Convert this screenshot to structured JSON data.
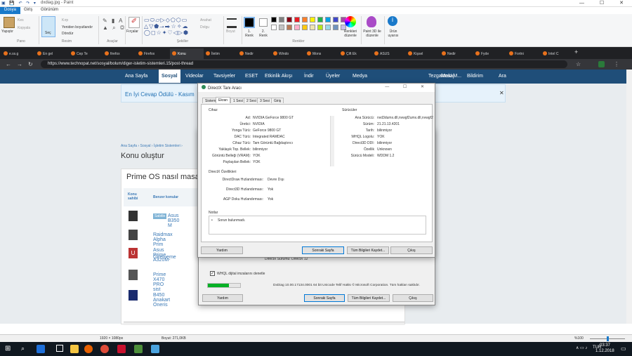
{
  "paint": {
    "title": "dxdiag.jpg - Paint",
    "tabs": [
      "Dosya",
      "Giriş",
      "Görünüm"
    ],
    "clipboard": {
      "paste": "Yapıştır",
      "cut": "Kes",
      "copy": "Kopyala",
      "group": "Pano"
    },
    "image": {
      "select": "Seç",
      "crop": "Kırp",
      "resize": "Yeniden boyutlandır",
      "rotate": "Döndür",
      "group": "Resim"
    },
    "tools": {
      "group": "Araçlar"
    },
    "brushes": "Fırçalar",
    "shapes": {
      "outline": "Anahat",
      "fill": "Dolgu",
      "group": "Şekiller"
    },
    "size": "Boyut",
    "color1": "1. Renk",
    "color2": "2. Renk",
    "edit_colors": "Renkleri düzenle",
    "paint3d": "Paint 3D ile düzenle",
    "product_alert": "Ürün uyarısı",
    "colors_group": "Renkler",
    "palette": [
      "#000000",
      "#7f7f7f",
      "#880015",
      "#ed1c24",
      "#ff7f27",
      "#fff200",
      "#22b14c",
      "#00a2e8",
      "#3f48cc",
      "#a349a4",
      "#ffffff",
      "#c3c3c3",
      "#b97a57",
      "#ffaec9",
      "#ffc90e",
      "#efe4b0",
      "#b5e61d",
      "#99d9ea",
      "#7092be",
      "#c8bfe7"
    ],
    "status": {
      "dimensions": "1920 × 1080px",
      "size": "Boyut: 271,0KB",
      "zoom": "%100"
    }
  },
  "browser": {
    "tabs": [
      "e.ss.g",
      "En gel",
      "Cep Te",
      "firefox",
      "Firefox",
      "Konu",
      "İletim",
      "Nedir",
      "Windo",
      "Mons",
      "Çift Ek",
      "ASUS",
      "Kişsel",
      "Nedir",
      "Fyde",
      "Fortni",
      "Intel C"
    ],
    "new_tab": "+",
    "url": "https://www.technopat.net/sosyal/bolum/diger-isletim-sistemleri.15/post-thread"
  },
  "site": {
    "nav": [
      "Ana Sayfa",
      "Sosyal",
      "Videolar",
      "Tavsiyeler",
      "ESET",
      "Etkinlik Akışı",
      "İndir",
      "Üyeler",
      "Medya"
    ],
    "nav_right": [
      "Tezgahtaki M...",
      "Mesaj",
      "Bildirim",
      "Ara"
    ],
    "notice": "En İyi Cevap Ödülü - Kasım",
    "breadcrumb": "Ana Sayfa › Sosyal › İşletim Sistemleri ›",
    "page_title": "Konu oluştur",
    "panel_title": "Prime OS nasıl masa",
    "col_owner": "Konu sahibi",
    "col_similar": "Benzer konular",
    "rows": [
      {
        "badge": "Sabitle",
        "text": "Asus B350 M"
      },
      {
        "text": "Raidmax Alpha Prim"
      },
      {
        "text": "Asus Prime A320M-",
        "text2": "Girememe"
      },
      {
        "text": "Prime X470 PRO sist"
      },
      {
        "text": "B450 Anakart Öneris"
      }
    ]
  },
  "dxdiag": {
    "title": "DirectX Tanı Aracı",
    "tabs": [
      "Sistem",
      "Ekran",
      "1 Sesi",
      "2 Sesi",
      "3 Sesi",
      "Giriş"
    ],
    "device_header": "Cihaz",
    "device": [
      [
        "Ad:",
        "NVIDIA GeForce 9800 GT"
      ],
      [
        "Üretici:",
        "NVIDIA"
      ],
      [
        "Yonga Türü:",
        "GeForce 9800 GT"
      ],
      [
        "DAC Türü:",
        "Integrated RAMDAC"
      ],
      [
        "Cihaz Türü:",
        "Tam Görüntü Bağdaştırıcı"
      ],
      [
        "Yaklaşık Top. Bellek:",
        "bilinmiyor"
      ],
      [
        "Görüntü Belleği (VRAM):",
        "YOK"
      ],
      [
        "Paylaşılan Bellek:",
        "YOK"
      ]
    ],
    "drivers_header": "Sürücüler",
    "drivers": [
      [
        "Ana Sürücü:",
        "nvd3dumx.dll,nvwgf2umx.dll,nvwgf2u"
      ],
      [
        "Sürüm:",
        "21.21.13.4201"
      ],
      [
        "Tarih:",
        "bilinmiyor"
      ],
      [
        "WHQL Logolu:",
        "YOK"
      ],
      [
        "Direct3D DDI:",
        "bilinmiyor"
      ],
      [
        "Özellik",
        "Unknown"
      ],
      [
        "Sürücü Modeli:",
        "WDDM 1.2"
      ]
    ],
    "features_header": "DirectX Özellikleri",
    "features": [
      [
        "DirectDraw Hızlandırması:",
        "Devre Dışı"
      ],
      [
        "Direct3D Hızlandırması:",
        "Yok"
      ],
      [
        "AGP Doku Hızlandırması:",
        "Yok"
      ]
    ],
    "notes_header": "Notlar",
    "notes": "Sorun bulunmadı.",
    "buttons": {
      "help": "Yardım",
      "next": "Sonraki Sayfa",
      "save": "Tüm Bilgileri Kaydet...",
      "exit": "Çıkış"
    }
  },
  "dxdiag_back": {
    "directx_version": "DirectX Sürümü:  DirectX 12",
    "whql_check": "WHQL dijital imzalarını denetle",
    "progress": 0.65,
    "footer": "DxDiag 10.00.17134.0001 64 bit Unicode  Telif Hakkı © Microsoft Corporation. Tüm hakları saklıdır."
  },
  "taskbar": {
    "time": "03:37",
    "date": "1.12.2018",
    "lang": "TUR"
  }
}
